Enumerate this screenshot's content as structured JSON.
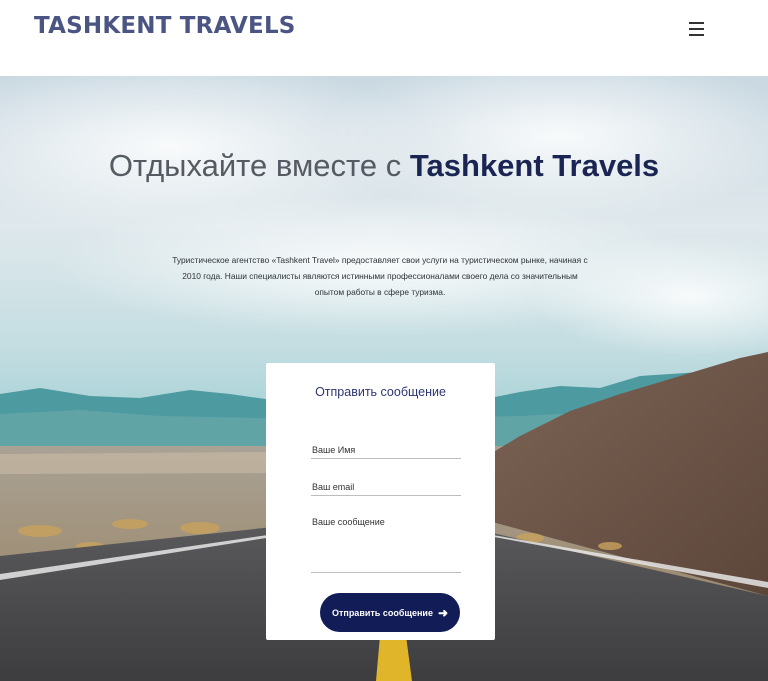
{
  "header": {
    "logo": "TASHKENT TRAVELS",
    "menu_icon": "hamburger-menu-icon"
  },
  "hero": {
    "headline_prefix": "Отдыхайте вместе с",
    "headline_brand": "Tashkent Travels",
    "description": "Туристическое агентство «Tashkent Travel» предоставляет свои услуги на туристическом рынке, начиная с 2010 года. Наши специалисты являются истинными профессионалами своего дела со значительным опытом работы в сфере туризма.",
    "background": "desert-road-photo"
  },
  "contact_form": {
    "title": "Отправить сообщение",
    "name_placeholder": "Ваше Имя",
    "email_placeholder": "Ваш email",
    "message_placeholder": "Ваше сообщение",
    "submit_label": "Отправить сообщение",
    "submit_icon": "arrow-right-icon"
  },
  "colors": {
    "brand": "#4b5583",
    "headline_brand": "#1b2553",
    "button": "#121c57"
  }
}
